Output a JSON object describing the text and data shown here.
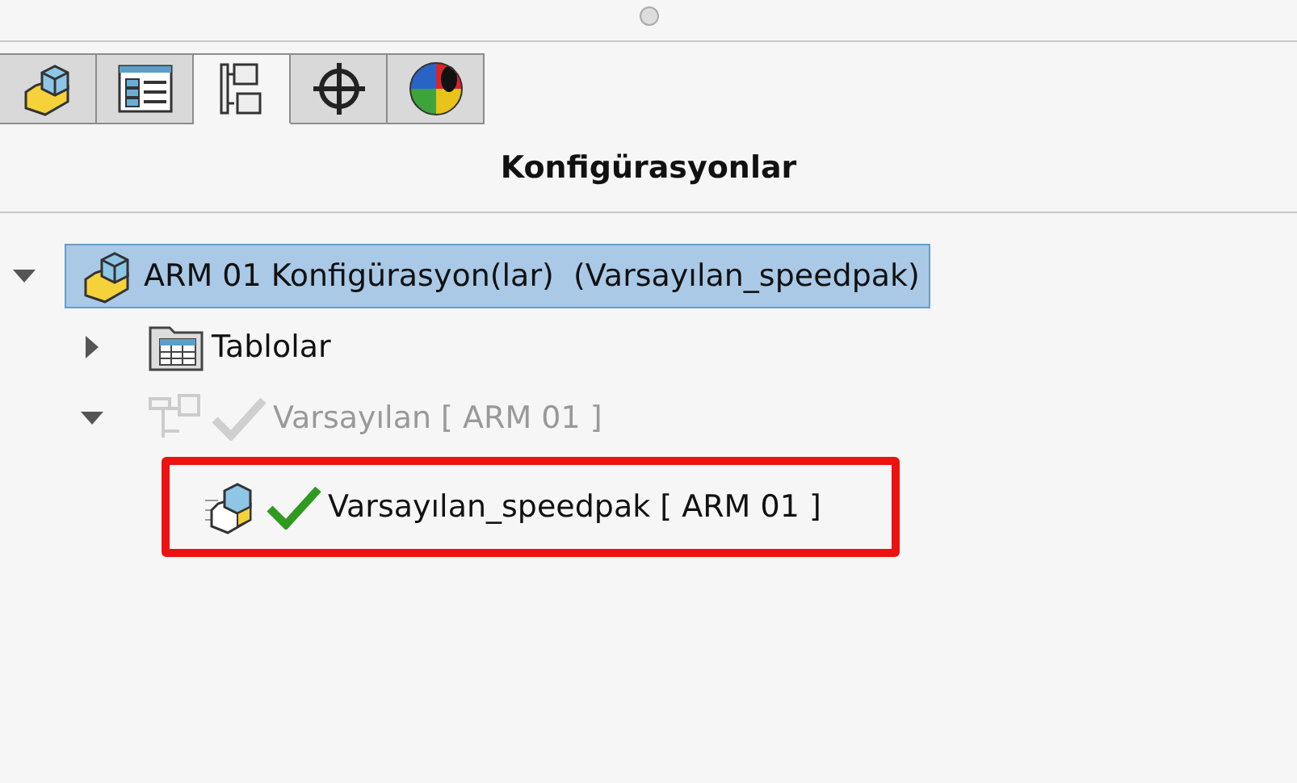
{
  "tabs": [
    {
      "kind": "part",
      "selected": false
    },
    {
      "kind": "property-list",
      "selected": false
    },
    {
      "kind": "configuration",
      "selected": true
    },
    {
      "kind": "crosshair",
      "selected": false
    },
    {
      "kind": "appearance",
      "selected": false
    }
  ],
  "panel": {
    "title": "Konfigürasyonlar"
  },
  "tree": [
    {
      "kind": "part",
      "label": "ARM 01 Konfigürasyon(lar)  (Varsayılan_speedpak)",
      "selected": true,
      "expanded": true,
      "children": [
        {
          "kind": "table-folder",
          "label": "Tablolar",
          "selected": false,
          "expanded": false
        },
        {
          "kind": "configuration",
          "label": "Varsayılan [ ARM 01 ]",
          "selected": false,
          "expanded": true,
          "disabled": true,
          "checked": true,
          "highlighted": false,
          "children": [
            {
              "kind": "speedpak",
              "label": "Varsayılan_speedpak [ ARM 01 ]",
              "selected": false,
              "disabled": false,
              "checked": true,
              "highlighted": true
            }
          ]
        }
      ]
    }
  ]
}
